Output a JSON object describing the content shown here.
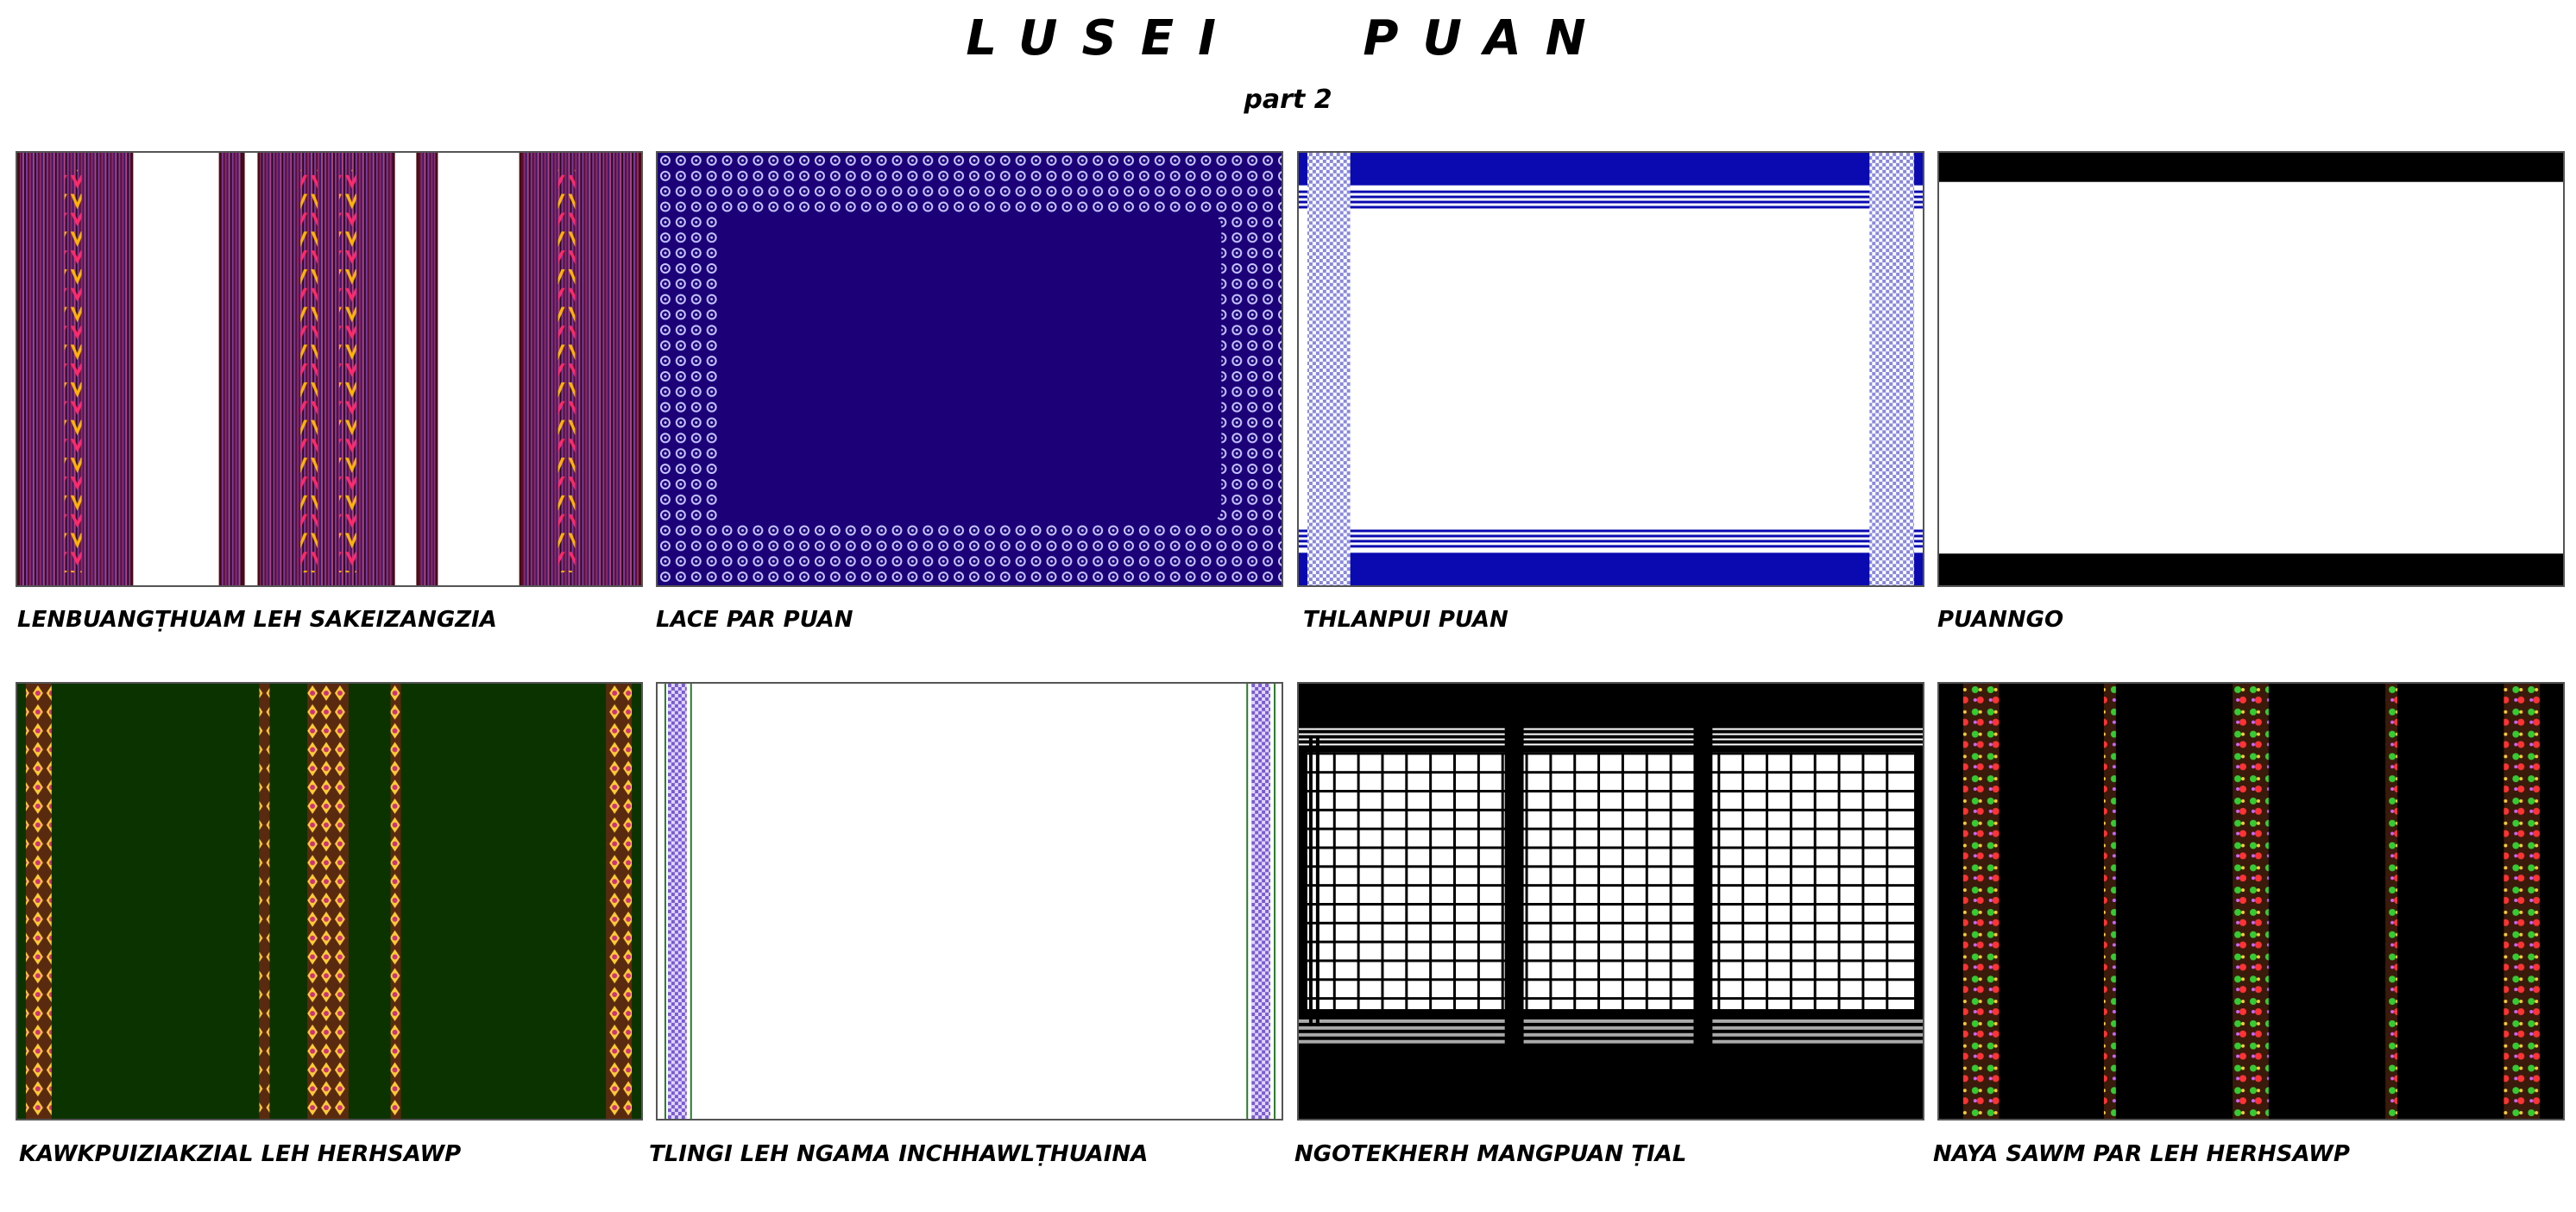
{
  "title": "LUSEI   PUAN",
  "subtitle": "part 2",
  "panels": [
    {
      "caption": "LENBUANGṬHUAM LEH SAKEIZANGZIA"
    },
    {
      "caption": "LACE PAR PUAN"
    },
    {
      "caption": "THLANPUI PUAN"
    },
    {
      "caption": "PUANNGO"
    },
    {
      "caption": "KAWKPUIZIAKZIAL LEH HERHSAWP"
    },
    {
      "caption": "TLINGI LEH NGAMA INCHHAWLṬHUAINA"
    },
    {
      "caption": "NGOTEKHERH MANGPUAN ṬIAL"
    },
    {
      "caption": "NAYA SAWM PAR LEH HERHSAWP"
    }
  ],
  "colors": {
    "navy": "#1b0078",
    "royal_blue": "#0a0ab0",
    "dark_green": "#0b3300",
    "black": "#000000",
    "maroon": "#4a0a12"
  }
}
